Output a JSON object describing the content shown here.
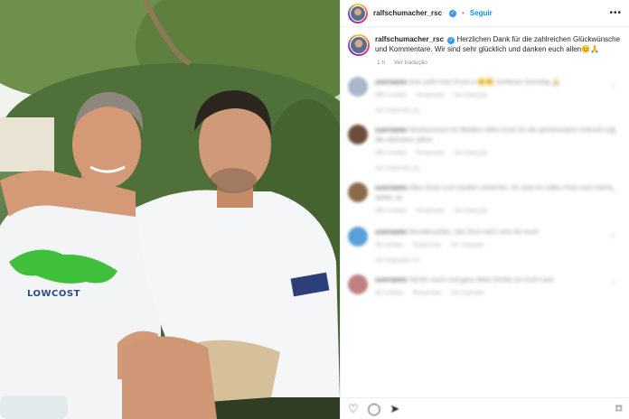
{
  "post": {
    "username": "ralfschumacher_rsc",
    "separator": "•",
    "follow_label": "Seguir",
    "more_label": "•••",
    "caption_text": "Herzlichen Dank für die zahlreichen Glückwünsche und Kommentare. Wir sind sehr glücklich und danken euch allen😊🙏",
    "time_ago": "1 h",
    "translate_label": "Ver tradução"
  },
  "photo": {
    "shirt_text": "LOWCOST"
  },
  "comments": [
    {
      "user": "username",
      "text": "Das sieht man Euch a 😊😊 Schönen Sonntag 🙏",
      "likes": "999 curtidas",
      "reply": "Responder",
      "translate": "Ver tradução",
      "replies": "Ver respostas (1)"
    },
    {
      "user": "username",
      "text": "Glückwunsch ihr Beiden! Alles Gute für die gemeinsame Zukunft und die nächsten Jahre",
      "likes": "999 curtidas",
      "reply": "Responder",
      "translate": "Ver tradução",
      "replies": "Ver respostas (1)"
    },
    {
      "user": "username",
      "text": "Alles Gute euch beiden weiterhin, ihr seid ein tolles Paar und macht weiter so",
      "likes": "999 curtidas",
      "reply": "Responder",
      "translate": "Ver tradução",
      "replies": ""
    },
    {
      "user": "username",
      "text": "Wunderschön, das freut mich sehr für euch",
      "likes": "99 curtidas",
      "reply": "Responder",
      "translate": "Ver tradução",
      "replies": "Ver respostas (1)"
    },
    {
      "user": "username",
      "text": "Toll für euch und ganz liebe Grüße an euch zwei",
      "likes": "99 curtidas",
      "reply": "Responder",
      "translate": "Ver tradução",
      "replies": ""
    }
  ],
  "icons": {
    "like": "heart-icon",
    "comment": "comment-icon",
    "share": "share-icon",
    "save": "bookmark-icon",
    "verified": "verified-badge-icon"
  },
  "colors": {
    "link_blue": "#0095f6",
    "verified_blue": "#3897f0",
    "text": "#262626",
    "muted": "#8e8e8e"
  }
}
